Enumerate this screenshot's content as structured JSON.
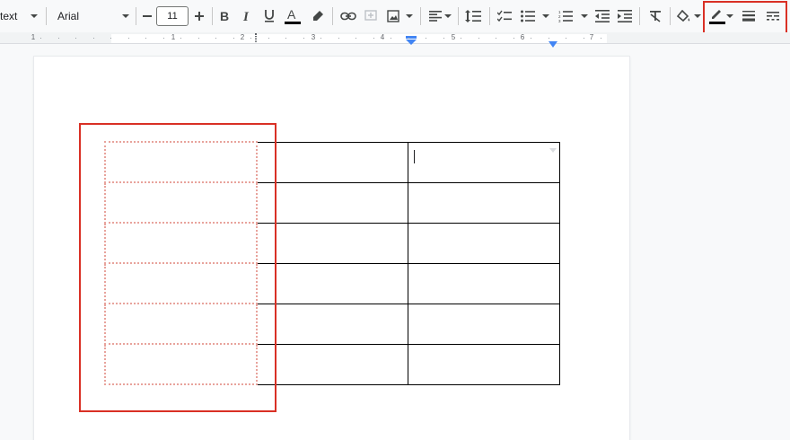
{
  "toolbar": {
    "style": "text",
    "font": "Arial",
    "font_size": "11",
    "icons": [
      "decrease-font-size",
      "increase-font-size",
      "bold",
      "italic",
      "underline",
      "text-color",
      "highlight",
      "insert-link",
      "add-comment",
      "insert-image",
      "align",
      "line-spacing",
      "checklist",
      "bulleted-list",
      "numbered-list",
      "decrease-indent",
      "increase-indent",
      "clear-formatting",
      "cell-background-color",
      "border-color",
      "border-width",
      "border-dash"
    ]
  },
  "ruler": {
    "numbers": [
      "1",
      "1",
      "2",
      "3",
      "4",
      "5",
      "6",
      "7"
    ]
  },
  "table": {
    "rows": 6,
    "columns": 3
  },
  "colors": {
    "highlight_box": "#d93025",
    "dotted_border": "#e8a39c",
    "ruler_marker": "#4285f4"
  }
}
